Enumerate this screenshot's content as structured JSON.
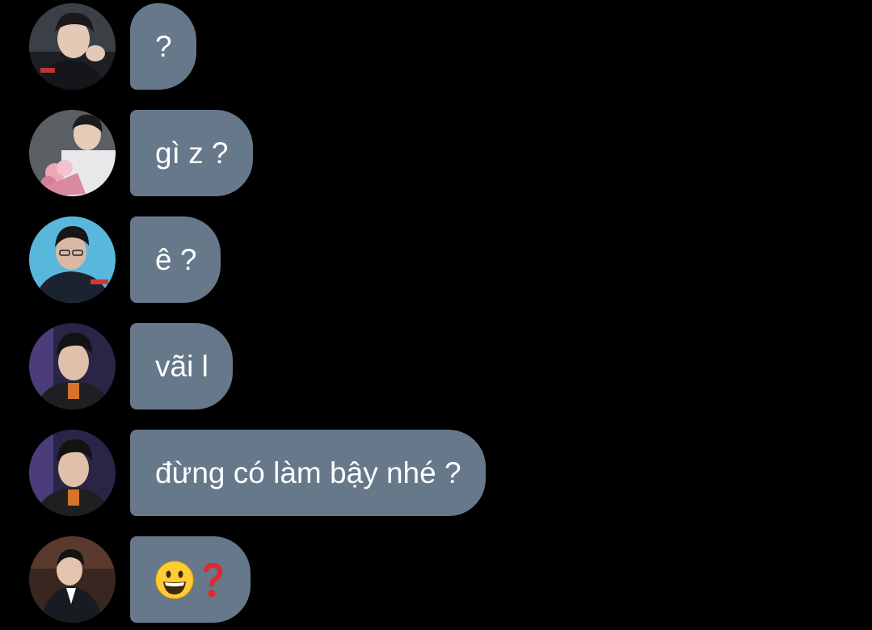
{
  "messages": [
    {
      "text": "?",
      "avatar": "avatar-person-1"
    },
    {
      "text": "gì z ?",
      "avatar": "avatar-person-2"
    },
    {
      "text": "ê ?",
      "avatar": "avatar-person-3"
    },
    {
      "text": "vãi l",
      "avatar": "avatar-person-4"
    },
    {
      "text": "đừng có làm bậy nhé ?",
      "avatar": "avatar-person-4"
    },
    {
      "emojis": [
        "grinning-face-emoji",
        "red-question-mark-emoji"
      ],
      "avatar": "avatar-person-5"
    }
  ],
  "colors": {
    "background": "#000000",
    "bubble": "#66788a",
    "text": "#ffffff"
  }
}
